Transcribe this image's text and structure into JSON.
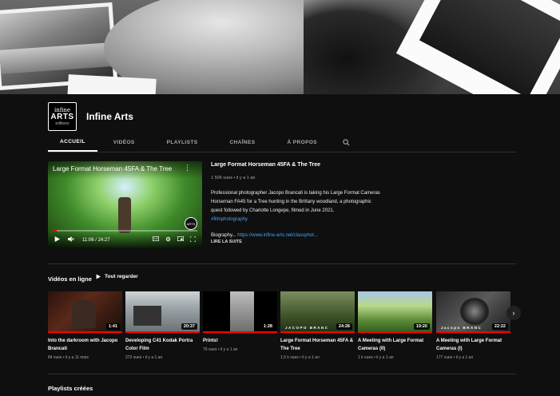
{
  "channel": {
    "logo": {
      "line1": "infine",
      "line2": "ARTS",
      "line3": "editions"
    },
    "name": "Infine Arts"
  },
  "tabs": [
    {
      "label": "ACCUEIL",
      "active": true
    },
    {
      "label": "VIDÉOS",
      "active": false
    },
    {
      "label": "PLAYLISTS",
      "active": false
    },
    {
      "label": "CHAÎNES",
      "active": false
    },
    {
      "label": "À PROPOS",
      "active": false
    }
  ],
  "featured": {
    "player_title": "Large Format Horseman 45FA & The Tree",
    "time": "11:06 / 24:27",
    "progress": 0.03,
    "watermark": "ARTS",
    "title": "Large Format Horseman 45FA & The Tree",
    "meta": "1 506 vues • il y a 1 an",
    "description": "Professional photographer Jacopo Brancati is taking his Large Format Cameras Horseman FA45 for a Tree hunting in the Brittany woodland, a photographic quest followed by Charlotte Longepe, filmed in June 2021.",
    "hashtag": "#filmphotography",
    "bio_label": "Biography...",
    "bio_link": "https://www.infine-arts.net/classphot...",
    "read_more": "LIRE LA SUITE"
  },
  "section": {
    "title": "Vidéos en ligne",
    "play_all": "Tout regarder"
  },
  "videos": [
    {
      "title": "Into the darkroom with Jacopo Brancati",
      "meta": "84 vues • il y a 11 mois",
      "duration": "1:41",
      "label": ""
    },
    {
      "title": "Developing C41 Kodak Portra Color Film",
      "meta": "272 vues • il y a 1 an",
      "duration": "20:37",
      "label": ""
    },
    {
      "title": "Prints!",
      "meta": "79 vues • il y a 1 an",
      "duration": "1:28",
      "label": ""
    },
    {
      "title": "Large Format Horseman 45FA & The Tree",
      "meta": "1,5 k vues • il y a 1 an",
      "duration": "24:28",
      "label": "JACOPO BRANC"
    },
    {
      "title": "A Meeting with Large Format Cameras (II)",
      "meta": "1 k vues • il y a 1 an",
      "duration": "19:20",
      "label": ""
    },
    {
      "title": "A Meeting with Large Format Cameras (I)",
      "meta": "177 vues • il y a 1 an",
      "duration": "22:22",
      "label": "Jacopo BRANC"
    }
  ],
  "section2": {
    "title": "Playlists créées"
  },
  "colors": {
    "background": "#0f0f0f",
    "accent": "#ff0000",
    "link": "#3ea6ff"
  }
}
